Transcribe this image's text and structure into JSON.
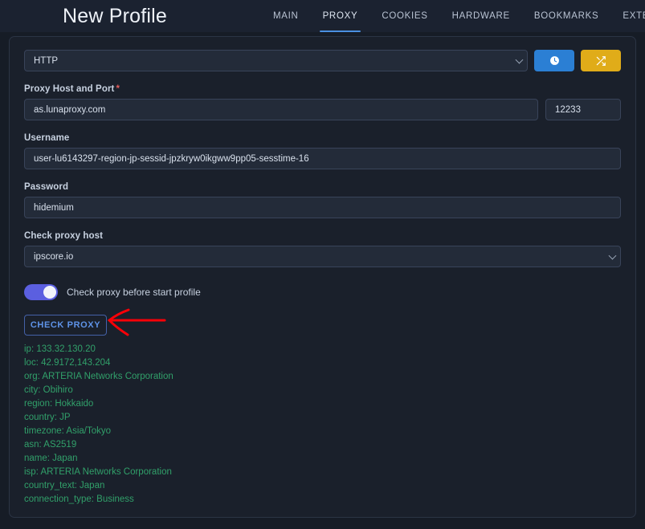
{
  "header": {
    "title": "New Profile",
    "tabs": [
      {
        "label": "MAIN",
        "active": false
      },
      {
        "label": "PROXY",
        "active": true
      },
      {
        "label": "COOKIES",
        "active": false
      },
      {
        "label": "HARDWARE",
        "active": false
      },
      {
        "label": "BOOKMARKS",
        "active": false
      },
      {
        "label": "EXTENSIONS",
        "active": false
      }
    ]
  },
  "proxy": {
    "type_select": {
      "value": "HTTP",
      "icon": "chevron-down-icon"
    },
    "info_button": {
      "icon": "clock-icon",
      "color": "#2b7fd4"
    },
    "shuffle_button": {
      "icon": "shuffle-icon",
      "color": "#e0ac19"
    },
    "host_port": {
      "label": "Proxy Host and Port",
      "required_marker": "*",
      "host_value": "as.lunaproxy.com",
      "port_value": "12233"
    },
    "username": {
      "label": "Username",
      "value": "user-lu6143297-region-jp-sessid-jpzkryw0ikgww9pp05-sesstime-16"
    },
    "password": {
      "label": "Password",
      "value": "hidemium"
    },
    "check_proxy_host": {
      "label": "Check proxy host",
      "value": "ipscore.io",
      "icon": "chevron-down-icon"
    },
    "check_before_start": {
      "label": "Check proxy before start profile",
      "enabled": true,
      "color": "#5b5fe0"
    },
    "check_button": {
      "label": "CHECK PROXY",
      "color": "#5e93e8"
    },
    "results_color": "#31a06a",
    "results": [
      "ip: 133.32.130.20",
      "loc: 42.9172,143.204",
      "org: ARTERIA Networks Corporation",
      "city: Obihiro",
      "region: Hokkaido",
      "country: JP",
      "timezone: Asia/Tokyo",
      "asn: AS2519",
      "name: Japan",
      "isp: ARTERIA Networks Corporation",
      "country_text: Japan",
      "connection_type: Business"
    ]
  },
  "annotation": {
    "name": "red-arrow",
    "color": "#fb0007"
  }
}
